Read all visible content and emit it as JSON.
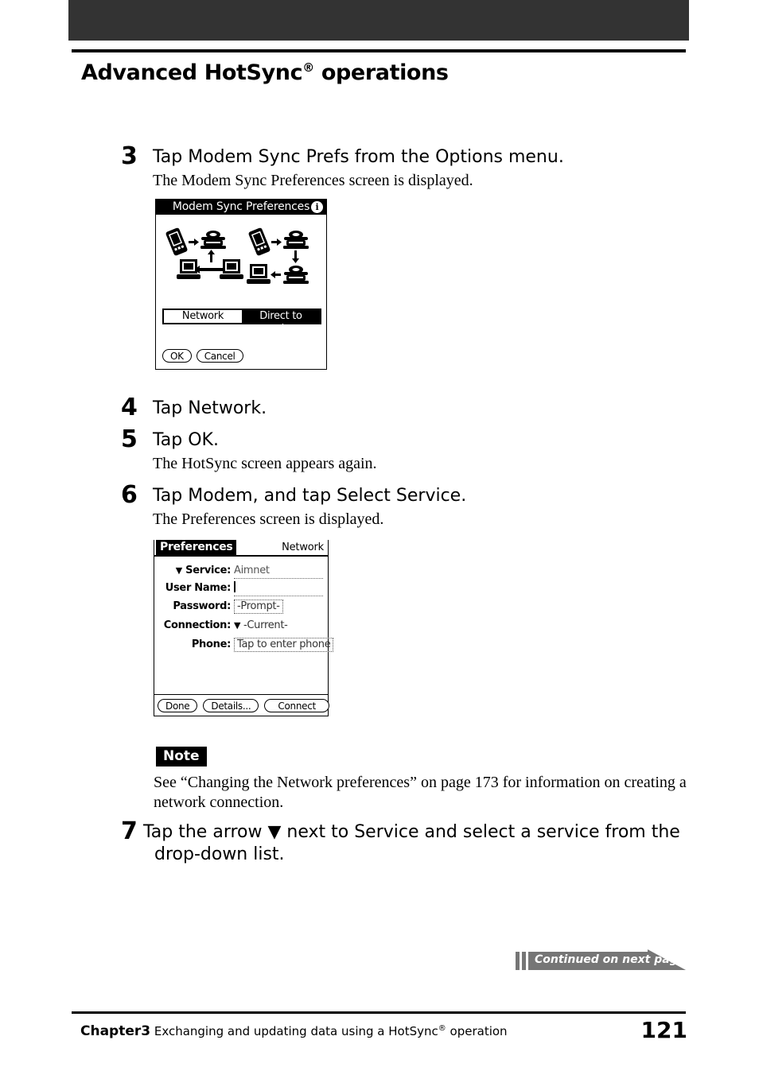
{
  "header": {
    "title_main": "Advanced HotSync",
    "title_sup": "®",
    "title_tail": " operations"
  },
  "steps": [
    {
      "number": "3",
      "title": "Tap Modem Sync Prefs from the Options menu.",
      "subtitle": "The Modem Sync Preferences screen is displayed."
    },
    {
      "number": "4",
      "title": "Tap Network.",
      "subtitle": ""
    },
    {
      "number": "5",
      "title": "Tap OK.",
      "subtitle": "The HotSync screen appears again."
    },
    {
      "number": "6",
      "title": "Tap Modem, and tap Select Service.",
      "subtitle": "The Preferences screen is displayed."
    },
    {
      "number": "7",
      "title_line1": "Tap the arrow ▼ next to Service and select a service from the",
      "title_line2": "drop-down list."
    }
  ],
  "modem_sync_screen": {
    "title": "Modem Sync Preferences",
    "info_icon": "i",
    "diagram_left_alt": "handheld to modem to two networked computers",
    "diagram_right_alt": "handheld to modem to modem to computer",
    "segments": [
      {
        "label": "Network",
        "selected": false
      },
      {
        "label": "Direct to modem",
        "selected": true
      }
    ],
    "buttons": [
      {
        "label": "OK"
      },
      {
        "label": "Cancel"
      }
    ]
  },
  "preferences_screen": {
    "tab_label": "Preferences",
    "category": "Network",
    "fields": [
      {
        "label": "Service:",
        "value": "Aimnet",
        "has_arrow": true
      },
      {
        "label": "User Name:",
        "value": "",
        "has_arrow": false
      },
      {
        "label": "Password:",
        "value": "-Prompt-",
        "has_arrow": false
      },
      {
        "label": "Connection:",
        "value": "-Current-",
        "has_arrow": true
      },
      {
        "label": "Phone:",
        "value": "Tap to enter phone",
        "has_arrow": false
      }
    ],
    "buttons": [
      {
        "label": "Done"
      },
      {
        "label": "Details..."
      },
      {
        "label": "Connect"
      }
    ]
  },
  "note": {
    "badge": "Note",
    "line1": "See “Changing the Network preferences” on page 173 for information on creating a",
    "line2": "network connection."
  },
  "continued_banner": {
    "text": "Continued on next page"
  },
  "footer": {
    "chapter": "Chapter3",
    "description_pre": " Exchanging and updating data using a HotSync",
    "description_sup": "®",
    "description_post": " operation",
    "page_number": "121"
  },
  "colors": {
    "top_bar": "#333333",
    "banner_gray": "#767676",
    "ink": "#000000",
    "paper": "#ffffff"
  }
}
